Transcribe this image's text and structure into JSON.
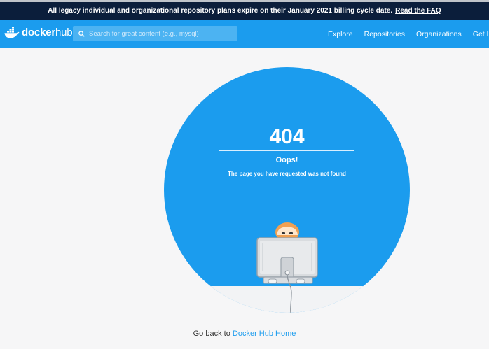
{
  "banner": {
    "text": "All legacy individual and organizational repository plans expire on their January 2021 billing cycle date.",
    "link": "Read the FAQ"
  },
  "header": {
    "logo_docker": "docker",
    "logo_hub": "hub",
    "search_placeholder": "Search for great content (e.g., mysql)",
    "nav": [
      "Explore",
      "Repositories",
      "Organizations",
      "Get Help"
    ]
  },
  "error": {
    "code": "404",
    "title": "Oops!",
    "message": "The page you have requested was not found"
  },
  "footer": {
    "prefix": "Go back to",
    "link": "Docker Hub Home"
  },
  "colors": {
    "banner_bg": "#0b1e3b",
    "brand_blue": "#1b9cee",
    "page_bg": "#f6f6f7"
  },
  "icons": [
    "docker-whale-logo-icon",
    "search-icon",
    "monitor-person-illustration"
  ]
}
